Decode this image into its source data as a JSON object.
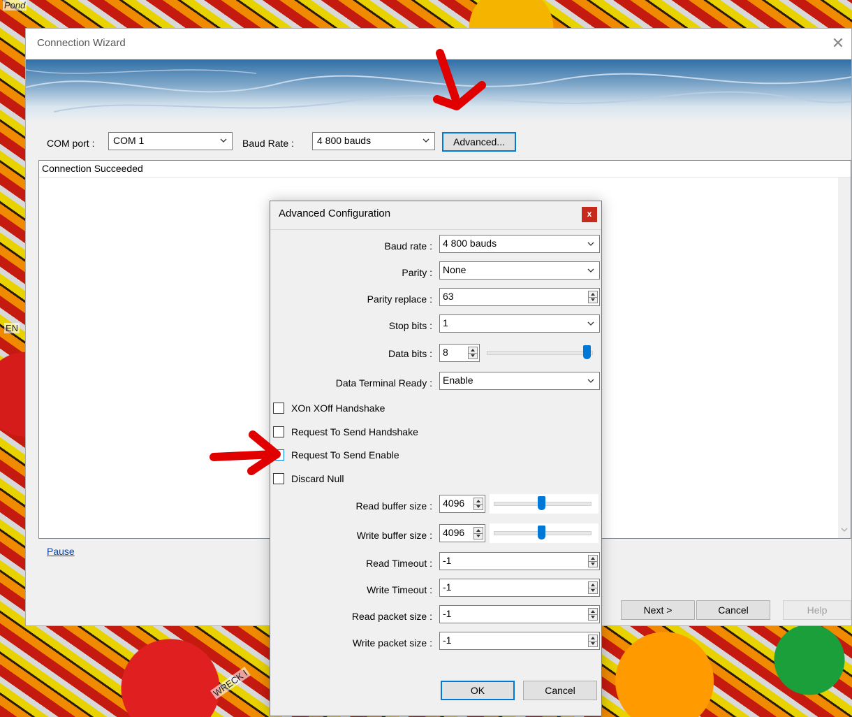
{
  "background": {
    "map_labels": [
      "Pond",
      "EN",
      "WRECK I"
    ]
  },
  "wizard": {
    "title": "Connection Wizard",
    "com_port_label": "COM port :",
    "com_port_value": "COM 1",
    "baud_rate_label": "Baud Rate :",
    "baud_rate_value": "4 800 bauds",
    "advanced_button": "Advanced...",
    "log_status": "Connection Succeeded",
    "pause_link": "Pause",
    "buttons": {
      "next": "Next >",
      "cancel": "Cancel",
      "help": "Help"
    }
  },
  "advanced": {
    "title": "Advanced Configuration",
    "close": "x",
    "baud_rate_label": "Baud rate :",
    "baud_rate_value": "4 800 bauds",
    "parity_label": "Parity :",
    "parity_value": "None",
    "parity_replace_label": "Parity replace :",
    "parity_replace_value": "63",
    "stop_bits_label": "Stop bits :",
    "stop_bits_value": "1",
    "data_bits_label": "Data bits :",
    "data_bits_value": "8",
    "dtr_label": "Data Terminal Ready :",
    "dtr_value": "Enable",
    "checkboxes": [
      {
        "label": "XOn XOff Handshake",
        "checked": false
      },
      {
        "label": "Request To Send Handshake",
        "checked": false
      },
      {
        "label": "Request To Send Enable",
        "checked": false
      },
      {
        "label": "Discard Null",
        "checked": false
      }
    ],
    "read_buffer_label": "Read buffer size :",
    "read_buffer_value": "4096",
    "write_buffer_label": "Write buffer size :",
    "write_buffer_value": "4096",
    "read_timeout_label": "Read Timeout :",
    "read_timeout_value": "-1",
    "write_timeout_label": "Write Timeout :",
    "write_timeout_value": "-1",
    "read_packet_label": "Read packet size :",
    "read_packet_value": "-1",
    "write_packet_label": "Write packet size :",
    "write_packet_value": "-1",
    "ok_button": "OK",
    "cancel_button": "Cancel"
  },
  "colors": {
    "accent": "#0078d7",
    "annotation_arrow": "#e00000",
    "close_red": "#c42b1c"
  }
}
